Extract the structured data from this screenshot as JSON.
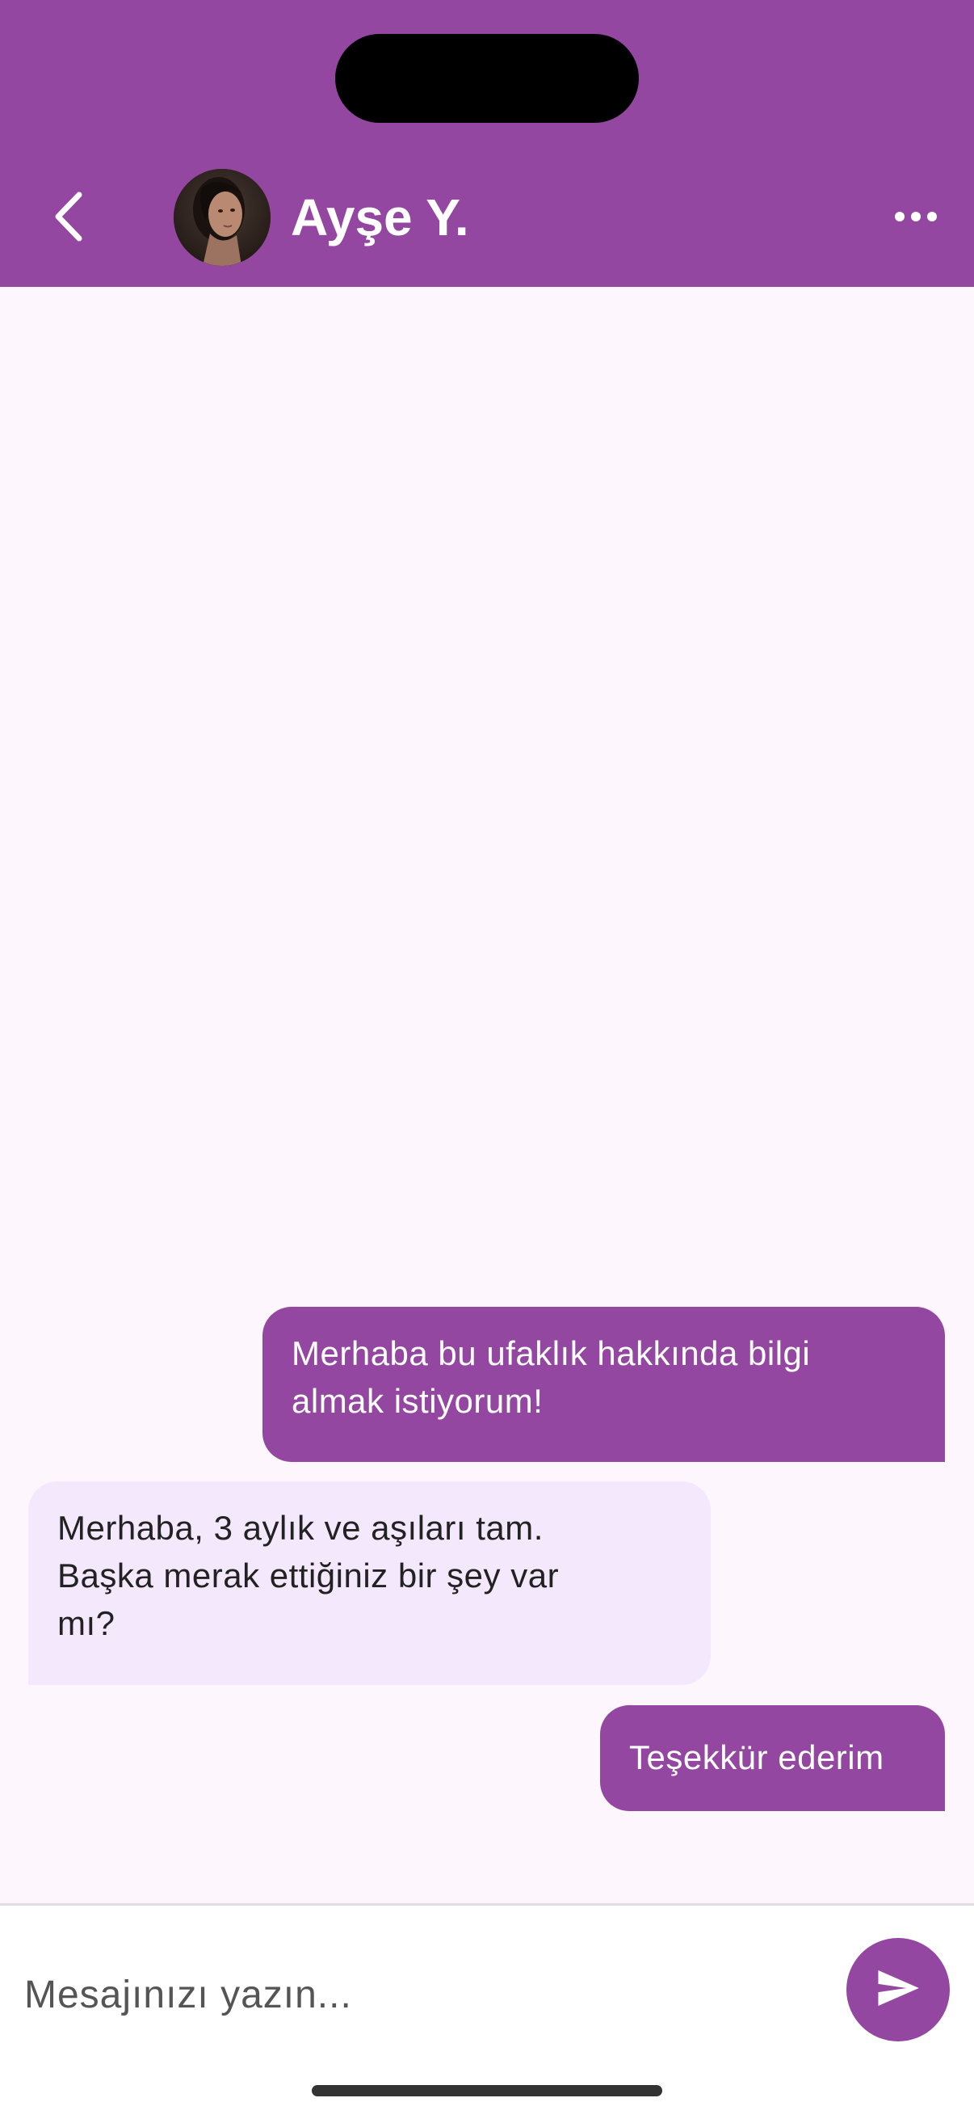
{
  "header": {
    "contact_name": "Ayşe  Y.",
    "back_icon": "chevron-left-icon",
    "more_icon": "more-horizontal-icon",
    "background_color": "#9347A0"
  },
  "messages": [
    {
      "direction": "outgoing",
      "lines": [
        "Merhaba bu ufaklık hakkında bilgi",
        "almak istiyorum!"
      ]
    },
    {
      "direction": "incoming",
      "lines": [
        "Merhaba, 3 aylık ve aşıları tam.",
        "Başka merak ettiğiniz bir şey var",
        "mı?"
      ]
    },
    {
      "direction": "outgoing",
      "lines": [
        "Teşekkür ederim"
      ]
    }
  ],
  "composer": {
    "placeholder": "Mesajınızı yazın...",
    "value": "",
    "send_icon": "send-icon"
  },
  "colors": {
    "accent": "#9347A0",
    "incoming_bubble": "#F4E8FC",
    "chat_background": "#FDF6FD"
  }
}
